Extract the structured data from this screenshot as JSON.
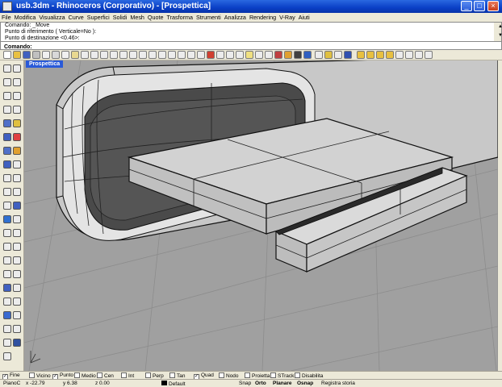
{
  "window": {
    "title": "usb.3dm - Rhinoceros (Corporativo) - [Prospettica]",
    "controls": [
      "_",
      "□",
      "×"
    ]
  },
  "menu": [
    "File",
    "Modifica",
    "Visualizza",
    "Curve",
    "Superfici",
    "Solidi",
    "Mesh",
    "Quote",
    "Trasforma",
    "Strumenti",
    "Analizza",
    "Rendering",
    "V-Ray",
    "Aiuti"
  ],
  "command_history": [
    "Comando: _Move",
    "Punto di riferimento ( Verticale=No ):",
    "Punto di destinazione <0.46>:"
  ],
  "command_prompt": "Comando:",
  "viewport": {
    "label": "Prospettica"
  },
  "osnaps": [
    {
      "label": "Fine",
      "checked": true
    },
    {
      "label": "Vicino",
      "checked": false
    },
    {
      "label": "Punto",
      "checked": true
    },
    {
      "label": "Medio",
      "checked": false
    },
    {
      "label": "Cen",
      "checked": false
    },
    {
      "label": "Int",
      "checked": false
    },
    {
      "label": "Perp",
      "checked": false
    },
    {
      "label": "Tan",
      "checked": false
    },
    {
      "label": "Quad",
      "checked": true
    },
    {
      "label": "Nodo",
      "checked": false
    },
    {
      "label": "Proietta",
      "checked": false
    },
    {
      "label": "STrack",
      "checked": false
    },
    {
      "label": "Disabilita",
      "checked": false
    }
  ],
  "status": {
    "cplane": "PianoC",
    "x": "x -22.79",
    "y": "y 6.38",
    "z": "z 0.00",
    "layer": "Default",
    "snap": "Snap",
    "ortho": "Orto",
    "planar": "Planare",
    "osnap": "Osnap",
    "history": "Registra storia"
  },
  "check_mark": "✓"
}
